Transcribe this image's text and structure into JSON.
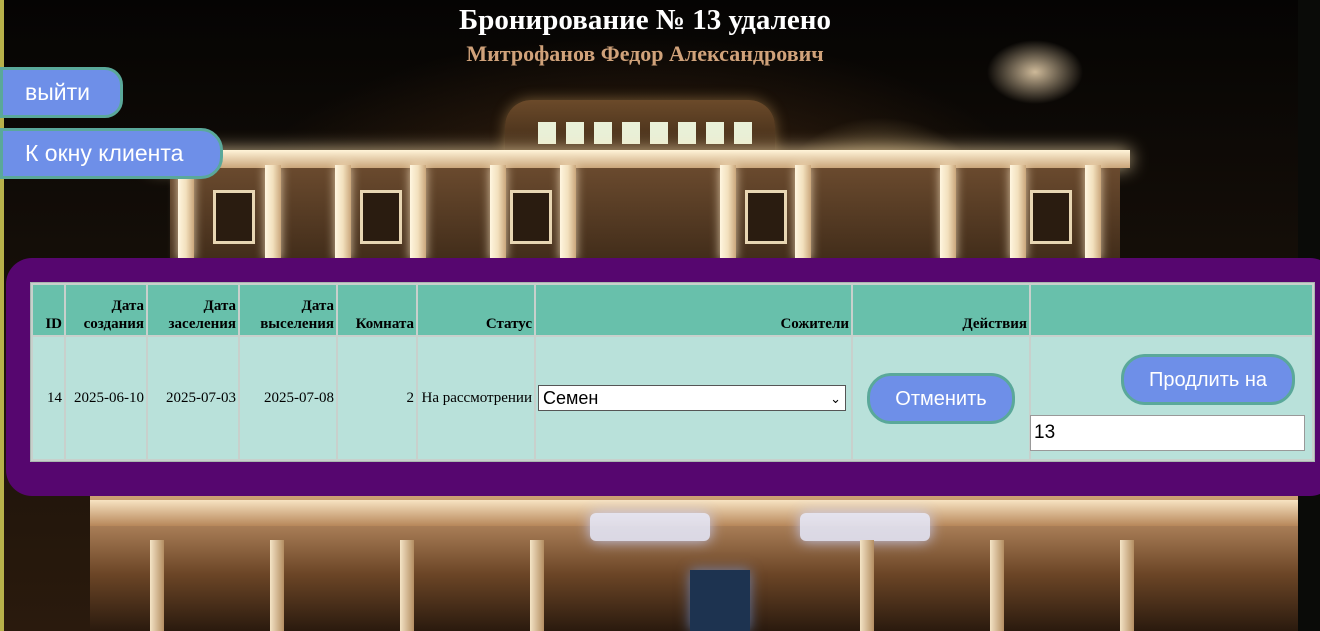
{
  "header": {
    "title": "Бронирование № 13 удалено",
    "user_name": "Митрофанов Федор Александрович"
  },
  "nav": {
    "logout_label": "выйти",
    "client_window_label": "К окну клиента"
  },
  "table": {
    "columns": [
      "ID",
      "Дата создания",
      "Дата заселения",
      "Дата выселения",
      "Комната",
      "Статус",
      "Сожители",
      "Действия",
      ""
    ],
    "rows": [
      {
        "id": "14",
        "created": "2025-06-10",
        "check_in": "2025-07-03",
        "check_out": "2025-07-08",
        "room": "2",
        "status": "На рассмотрении",
        "roommate_selected": "Семен",
        "cancel_label": "Отменить",
        "extend_label": "Продлить на",
        "extend_value": "13"
      }
    ]
  },
  "colors": {
    "button_bg": "#6e8fe8",
    "button_border": "#5aa89a",
    "panel_bg": "#56066f",
    "table_header_bg": "#68c0ab",
    "table_cell_bg": "#b9e1da",
    "subtitle": "#d0a27a"
  },
  "icons": {
    "select_arrow": "chevron-down-icon"
  }
}
